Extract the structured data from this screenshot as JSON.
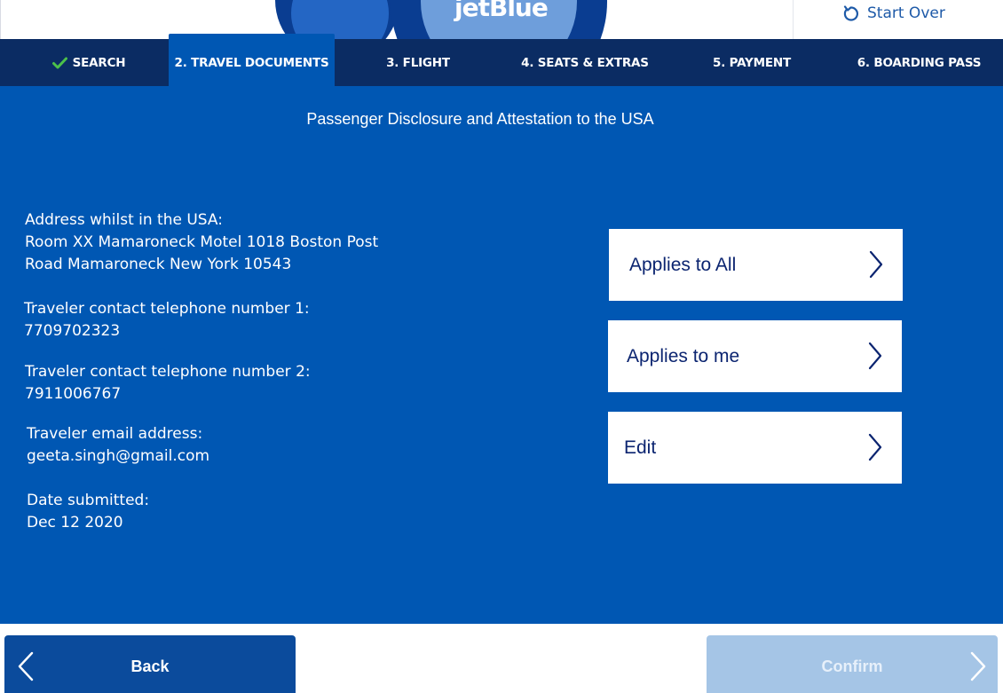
{
  "header": {
    "logo_text": "jetBlue",
    "logo_mark": "®",
    "start_over_label": "Start Over"
  },
  "steps": [
    {
      "label": "SEARCH",
      "state": "completed"
    },
    {
      "label": "2. TRAVEL DOCUMENTS",
      "state": "active"
    },
    {
      "label": "3. FLIGHT",
      "state": "upcoming"
    },
    {
      "label": "4. SEATS & EXTRAS",
      "state": "upcoming"
    },
    {
      "label": "5. PAYMENT",
      "state": "upcoming"
    },
    {
      "label": "6. BOARDING PASS",
      "state": "upcoming"
    }
  ],
  "main": {
    "title": "Passenger Disclosure and Attestation to the USA",
    "address": {
      "label": "Address whilst in the USA:",
      "line1": "Room XX Mamaroneck Motel 1018 Boston Post",
      "line2": "Road Mamaroneck New York 10543"
    },
    "phone1": {
      "label": "Traveler contact telephone number 1:",
      "value": "7709702323"
    },
    "phone2": {
      "label": "Traveler contact telephone number 2:",
      "value": "7911006767"
    },
    "email": {
      "label": "Traveler email address:",
      "value": "geeta.singh@gmail.com"
    },
    "date": {
      "label": "Date submitted:",
      "value": "Dec 12 2020"
    },
    "options": [
      {
        "label": "Applies to All"
      },
      {
        "label": "Applies to me"
      },
      {
        "label": "Edit"
      }
    ]
  },
  "footer": {
    "back_label": "Back",
    "confirm_label": "Confirm"
  },
  "colors": {
    "brand_dark": "#0b2c63",
    "brand_blue": "#0057b3",
    "option_text": "#0b2470",
    "confirm_disabled": "#a5c5e6",
    "check_green": "#4cc14a"
  },
  "icons": {
    "start_over": "refresh-icon",
    "completed_step": "check-icon",
    "option": "chevron-right-icon",
    "back": "chevron-left-icon",
    "confirm": "chevron-right-icon"
  }
}
